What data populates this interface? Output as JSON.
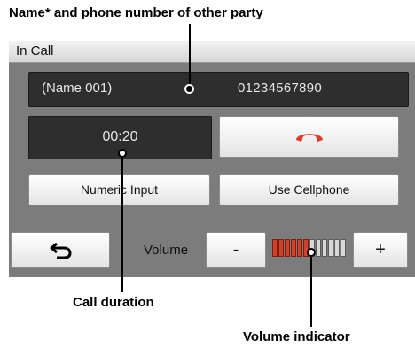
{
  "callouts": {
    "top": "Name* and phone number of other party",
    "duration": "Call duration",
    "volume": "Volume indicator"
  },
  "screen": {
    "title": "In Call",
    "party_name": "(Name 001)",
    "party_number": "01234567890",
    "duration": "00:20",
    "numeric_input_label": "Numeric Input",
    "use_cellphone_label": "Use Cellphone",
    "volume_label": "Volume",
    "minus_label": "-",
    "plus_label": "+",
    "volume_level": 6,
    "volume_max": 12
  },
  "icons": {
    "end_call": "end-call-icon",
    "back": "back-arrow-icon"
  },
  "colors": {
    "end_call": "#e23a2a",
    "volume_on": "#d0402a"
  }
}
